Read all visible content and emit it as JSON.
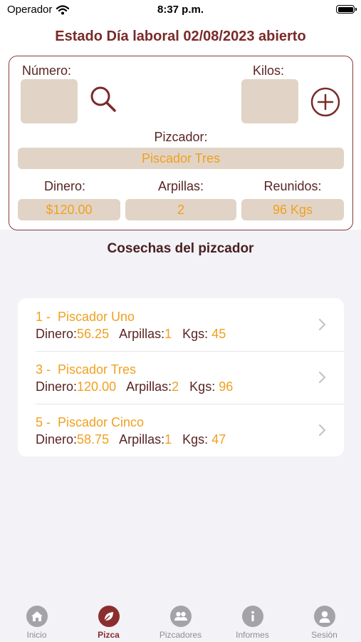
{
  "status_bar": {
    "carrier": "Operador",
    "time": "8:37 p.m."
  },
  "header": {
    "title": "Estado Día laboral 02/08/2023 abierto"
  },
  "form": {
    "numero_label": "Número:",
    "kilos_label": "Kilos:",
    "pizcador_label": "Pizcador:",
    "pizcador_value": "Piscador Tres",
    "dinero_label": "Dinero:",
    "dinero_value": "$120.00",
    "arpillas_label": "Arpillas:",
    "arpillas_value": "2",
    "reunidos_label": "Reunidos:",
    "reunidos_value": "96 Kgs"
  },
  "harvests": {
    "title": "Cosechas del pizcador",
    "dinero_label": "Dinero:",
    "arpillas_label": "Arpillas:",
    "kgs_label": "Kgs: ",
    "items": [
      {
        "name": "1 -  Piscador Uno",
        "dinero": "56.25",
        "arpillas": "1",
        "kgs": "45"
      },
      {
        "name": "3 -  Piscador Tres",
        "dinero": "120.00",
        "arpillas": "2",
        "kgs": "96"
      },
      {
        "name": "5 -  Piscador Cinco",
        "dinero": "58.75",
        "arpillas": "1",
        "kgs": "47"
      }
    ]
  },
  "tabs": [
    {
      "label": "Inicio",
      "icon": "home-icon"
    },
    {
      "label": "Pizca",
      "icon": "leaf-icon",
      "active": true
    },
    {
      "label": "Pizcadores",
      "icon": "people-icon"
    },
    {
      "label": "Informes",
      "icon": "info-icon"
    },
    {
      "label": "Sesión",
      "icon": "person-icon"
    }
  ],
  "colors": {
    "accent": "#8b2e2e",
    "value": "#f0a020",
    "field_bg": "#e1d4c6",
    "label": "#5a2424"
  }
}
